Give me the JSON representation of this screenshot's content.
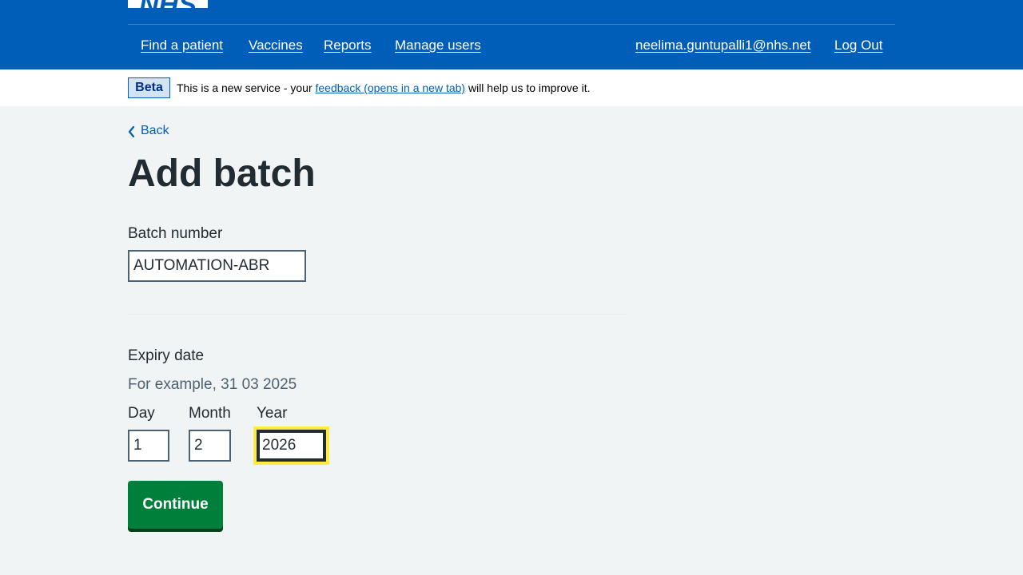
{
  "header": {
    "logo_text": "NHS",
    "nav": {
      "find_patient": "Find a patient",
      "vaccines": "Vaccines",
      "reports": "Reports",
      "manage_users": "Manage users",
      "user_email": "neelima.guntupalli1@nhs.net",
      "log_out": "Log Out"
    }
  },
  "beta_banner": {
    "tag": "Beta",
    "text_before": "This is a new service - your ",
    "link": "feedback (opens in a new tab)",
    "text_after": " will help us to improve it."
  },
  "back_link": "Back",
  "page_title": "Add batch",
  "batch_number": {
    "label": "Batch number",
    "value": "AUTOMATION-ABR"
  },
  "expiry_date": {
    "legend": "Expiry date",
    "hint": "For example, 31 03 2025",
    "day_label": "Day",
    "day_value": "1",
    "month_label": "Month",
    "month_value": "2",
    "year_label": "Year",
    "year_value": "2026"
  },
  "continue_button": "Continue",
  "colors": {
    "header_blue": "#005eb8",
    "page_background": "#f0f4f5",
    "button_green": "#007f3b",
    "focus_yellow": "#ffeb3b",
    "link_blue": "#005eb8"
  }
}
